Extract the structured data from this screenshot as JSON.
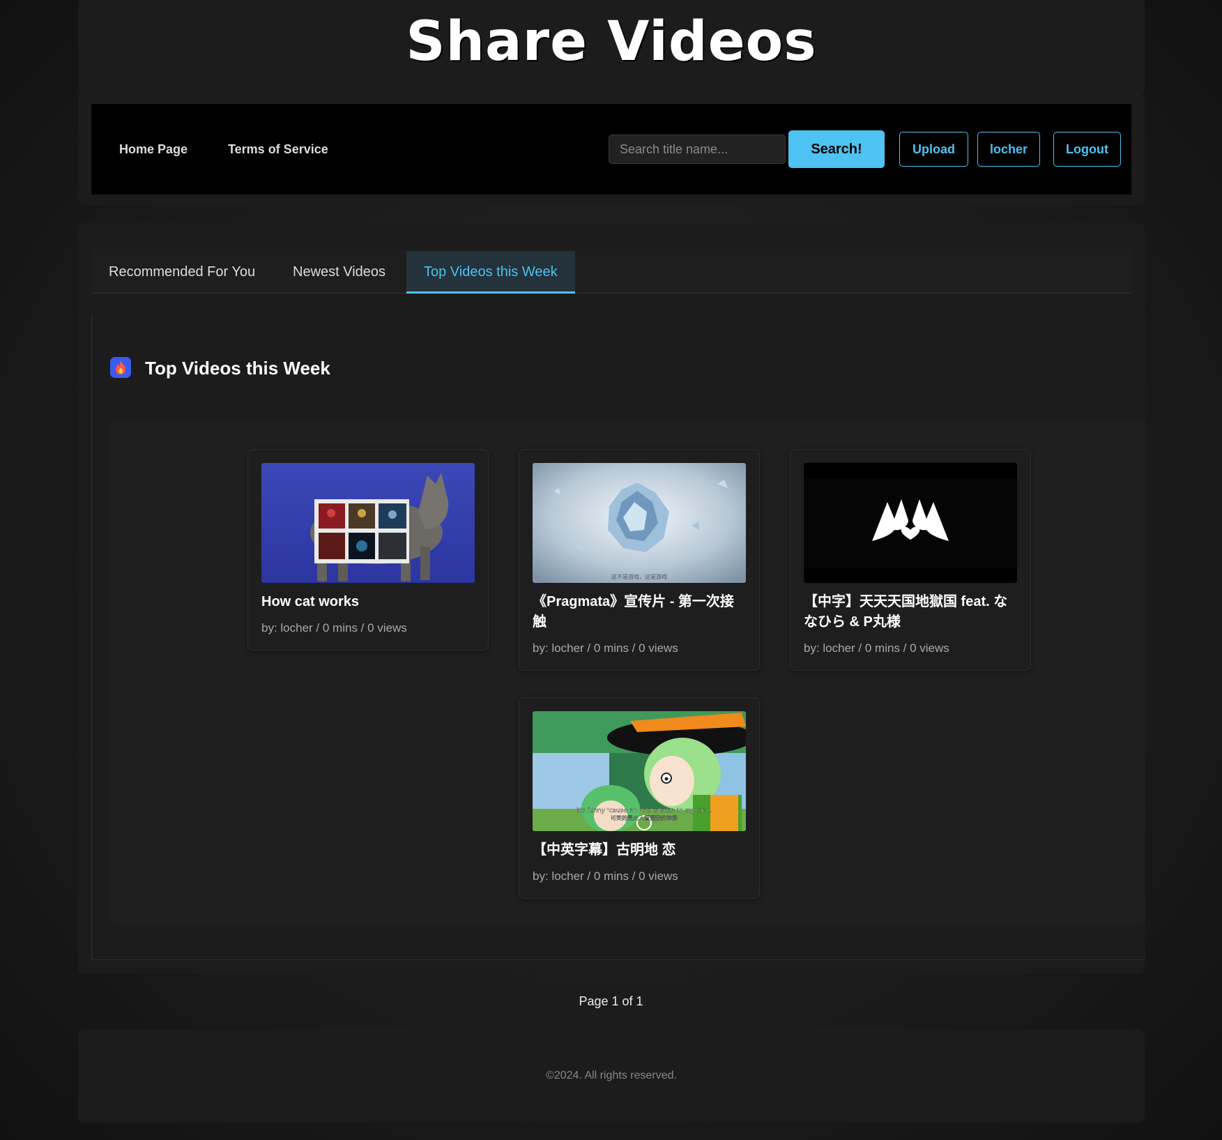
{
  "site": {
    "title": "Share Videos"
  },
  "nav": {
    "home": "Home Page",
    "terms": "Terms of Service",
    "search_placeholder": "Search title name...",
    "search_button": "Search!",
    "upload": "Upload",
    "user": "locher",
    "logout": "Logout"
  },
  "tabs": [
    {
      "label": "Recommended For You",
      "active": false
    },
    {
      "label": "Newest Videos",
      "active": false
    },
    {
      "label": "Top Videos this Week",
      "active": true
    }
  ],
  "section": {
    "title": "Top Videos this Week",
    "icon": "fire-icon"
  },
  "videos": [
    {
      "title": "How cat works",
      "meta": "by: locher / 0 mins / 0 views",
      "thumb": "cat-thumbnail"
    },
    {
      "title": "《Pragmata》宣传片 - 第一次接触",
      "meta": "by: locher / 0 mins / 0 views",
      "thumb": "crystal-thumbnail",
      "caption": "这不是游戏，这是游戏"
    },
    {
      "title": "【中字】天天天国地獄国 feat. ななひら & P丸様",
      "meta": "by: locher / 0 mins / 0 views",
      "thumb": "logo-thumbnail"
    },
    {
      "title": "【中英字幕】古明地 恋",
      "meta": "by: locher / 0 mins / 0 views",
      "thumb": "anime-thumbnail",
      "caption_en": "It's funny 'cause no one is keen to my kind.",
      "caption_zh": "可笑的是无人看透我的神族"
    }
  ],
  "pagination": {
    "text": "Page 1 of 1"
  },
  "footer": {
    "text": "©2024. All rights reserved."
  },
  "colors": {
    "accent": "#4ec2f2",
    "background": "#1b1b1b",
    "panel": "#1c1c1c"
  }
}
